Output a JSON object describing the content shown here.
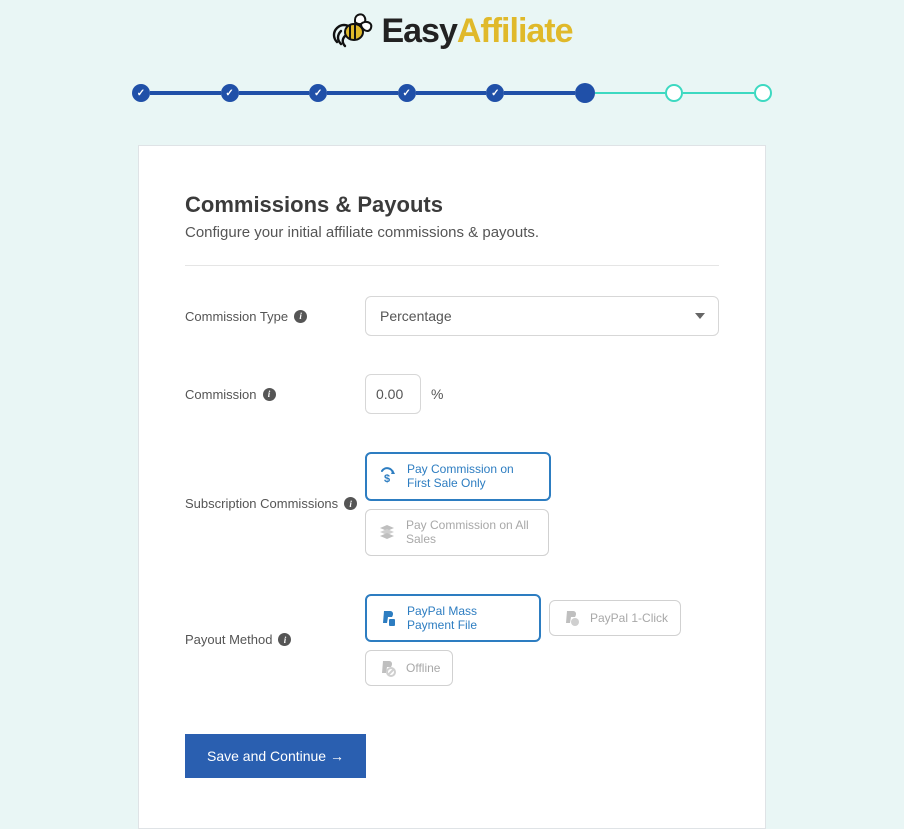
{
  "logo": {
    "part1": "Easy",
    "part2": "Affiliate"
  },
  "stepper": {
    "completed": 5,
    "current_index": 5,
    "total": 8
  },
  "header": {
    "title": "Commissions & Payouts",
    "subtitle": "Configure your initial affiliate commissions & payouts."
  },
  "fields": {
    "commission_type": {
      "label": "Commission Type",
      "value": "Percentage"
    },
    "commission": {
      "label": "Commission",
      "value": "0.00",
      "unit": "%"
    },
    "subscription_commissions": {
      "label": "Subscription Commissions",
      "options": [
        {
          "label": "Pay Commission on First Sale Only",
          "icon": "dollar-cycle-icon",
          "selected": true
        },
        {
          "label": "Pay Commission on All Sales",
          "icon": "stack-icon",
          "selected": false
        }
      ]
    },
    "payout_method": {
      "label": "Payout Method",
      "options": [
        {
          "label": "PayPal Mass Payment File",
          "icon": "paypal-icon",
          "selected": true
        },
        {
          "label": "PayPal 1-Click",
          "icon": "paypal-icon",
          "selected": false
        },
        {
          "label": "Offline",
          "icon": "paypal-offline-icon",
          "selected": false
        }
      ]
    }
  },
  "actions": {
    "save": "Save and Continue →"
  },
  "colors": {
    "brand_blue": "#2a5fb0",
    "accent_teal": "#3dd9c1",
    "brand_yellow": "#e0b92a"
  }
}
